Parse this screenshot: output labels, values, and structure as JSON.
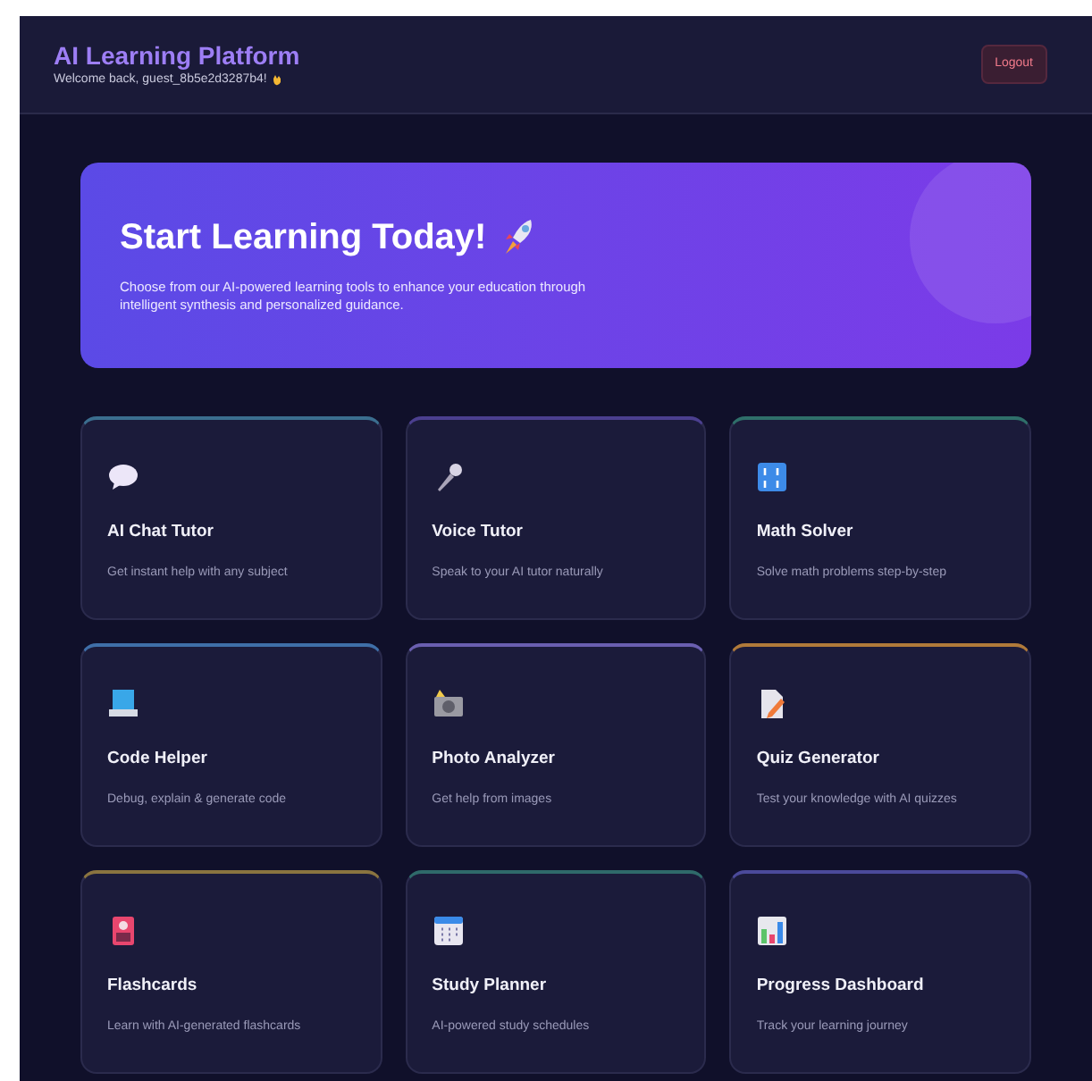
{
  "header": {
    "title": "AI Learning Platform",
    "welcome": "Welcome back, guest_8b5e2d3287b4!",
    "logout": "Logout"
  },
  "hero": {
    "title": "Start Learning Today!",
    "text": "Choose from our AI-powered learning tools to enhance your education through intelligent synthesis and personalized guidance."
  },
  "tools": [
    {
      "title": "AI Chat Tutor",
      "text": "Get instant help with any subject",
      "color": "#3b6e8f"
    },
    {
      "title": "Voice Tutor",
      "text": "Speak to your AI tutor naturally",
      "color": "#4b3f8f"
    },
    {
      "title": "Math Solver",
      "text": "Solve math problems step-by-step",
      "color": "#2f6f6a"
    },
    {
      "title": "Code Helper",
      "text": "Debug, explain & generate code",
      "color": "#3f6fa8"
    },
    {
      "title": "Photo Analyzer",
      "text": "Get help from images",
      "color": "#6a5fb0"
    },
    {
      "title": "Quiz Generator",
      "text": "Test your knowledge with AI quizzes",
      "color": "#b07a3a"
    },
    {
      "title": "Flashcards",
      "text": "Learn with AI-generated flashcards",
      "color": "#8a7440"
    },
    {
      "title": "Study Planner",
      "text": "AI-powered study schedules",
      "color": "#2f6a6a"
    },
    {
      "title": "Progress Dashboard",
      "text": "Track your learning journey",
      "color": "#4b4a9a"
    }
  ]
}
